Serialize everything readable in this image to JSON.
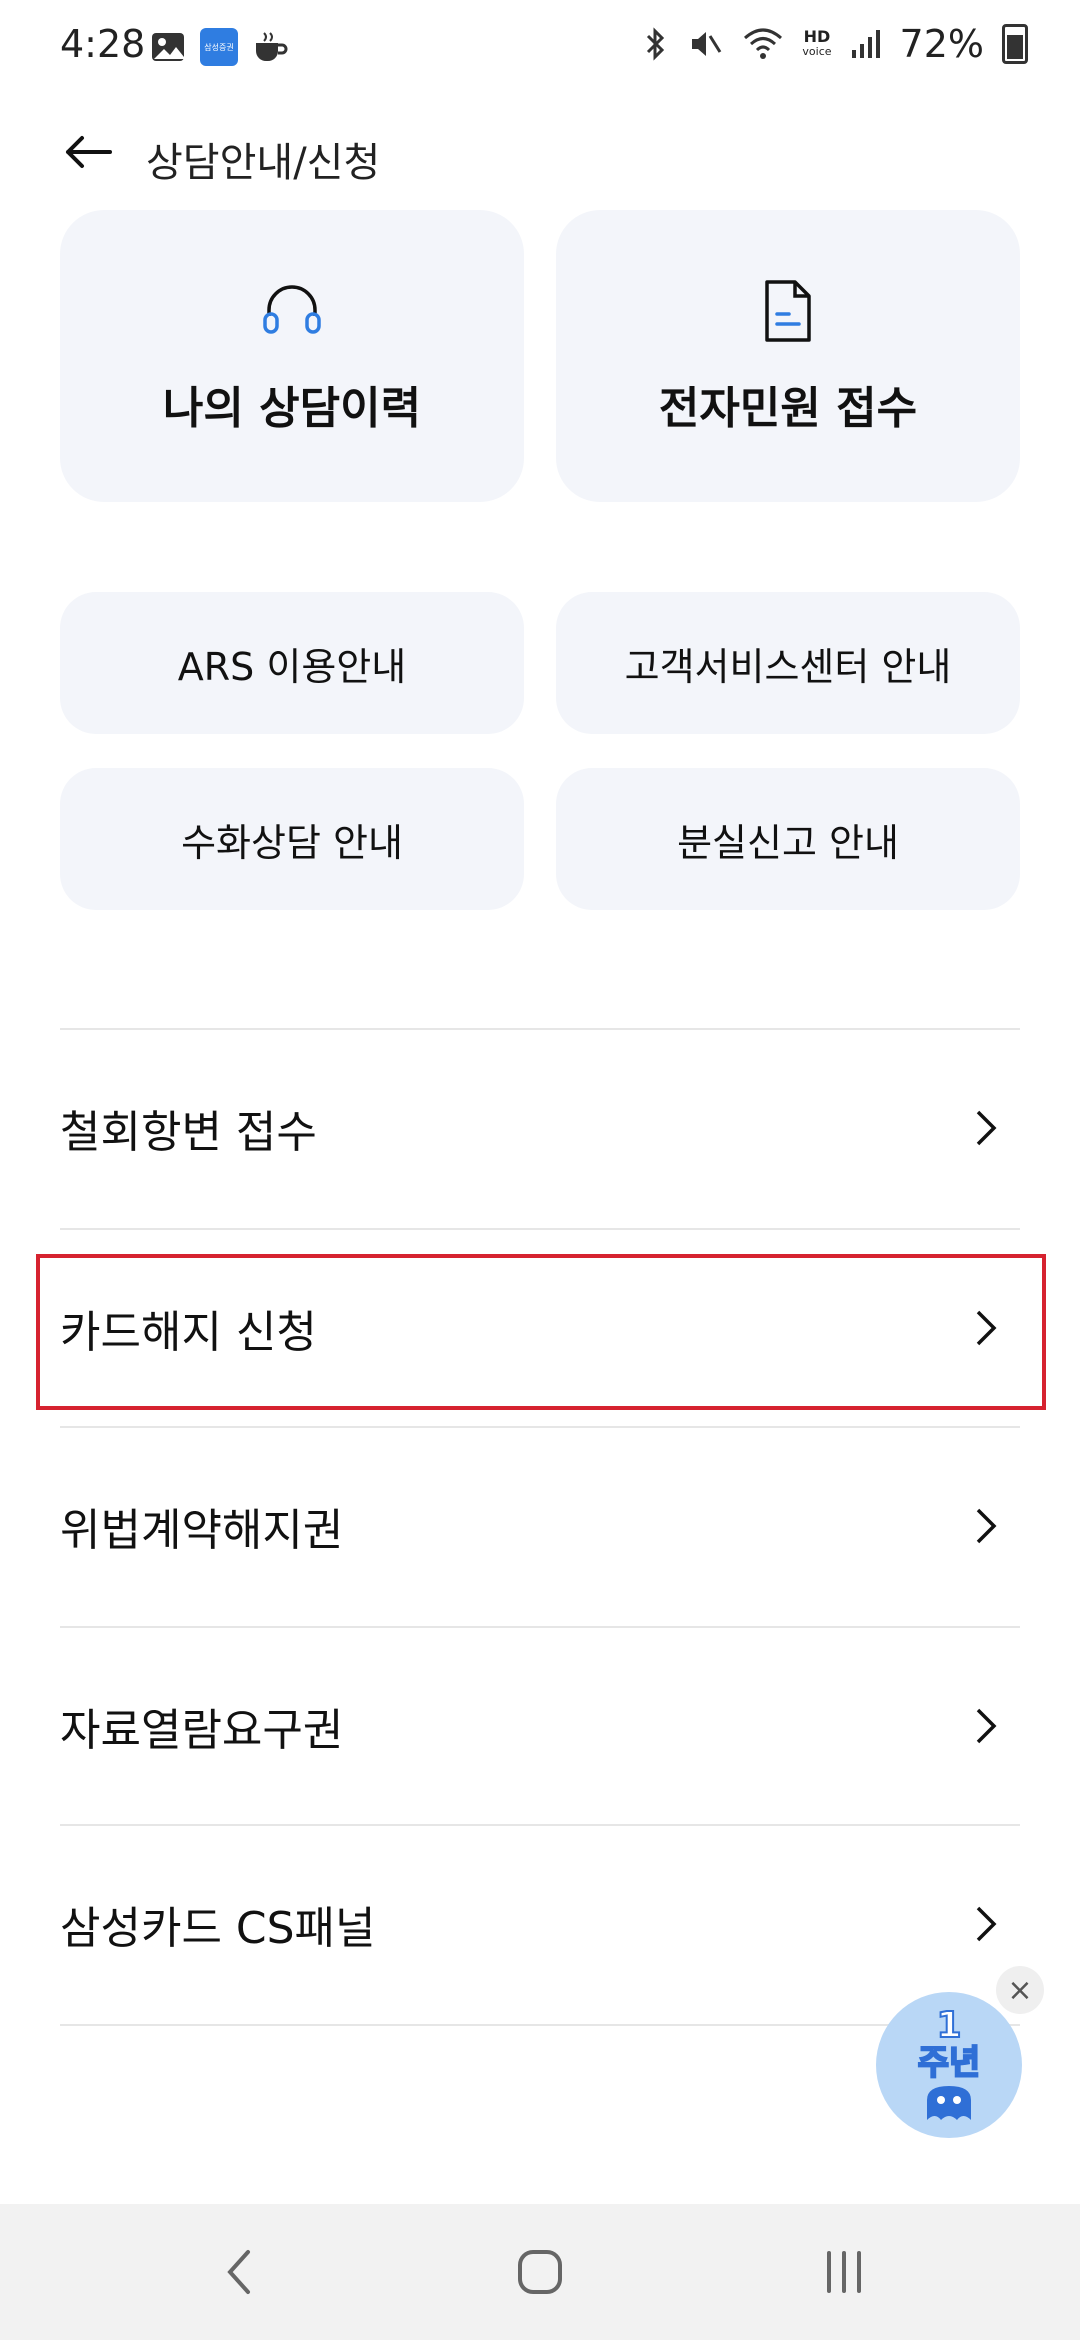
{
  "status_bar": {
    "time": "4:28",
    "app_icon_text": "삼성증권",
    "hd_top": "HD",
    "hd_bottom": "voice",
    "battery": "72%"
  },
  "header": {
    "title": "상담안내/신청"
  },
  "big_cards": [
    {
      "label": "나의 상담이력",
      "icon": "headset-icon"
    },
    {
      "label": "전자민원 접수",
      "icon": "document-icon"
    }
  ],
  "small_cards": [
    {
      "label": "ARS 이용안내"
    },
    {
      "label": "고객서비스센터 안내"
    },
    {
      "label": "수화상담 안내"
    },
    {
      "label": "분실신고 안내"
    }
  ],
  "list": [
    {
      "label": "철회항변 접수"
    },
    {
      "label": "카드해지 신청"
    },
    {
      "label": "위법계약해지권"
    },
    {
      "label": "자료열람요구권"
    },
    {
      "label": "삼성카드 CS패널"
    }
  ],
  "fab": {
    "number": "1",
    "text": "주년",
    "close": "×"
  },
  "colors": {
    "accent": "#2f7de1",
    "card_bg": "#f3f5fa",
    "highlight": "#d6222f"
  }
}
